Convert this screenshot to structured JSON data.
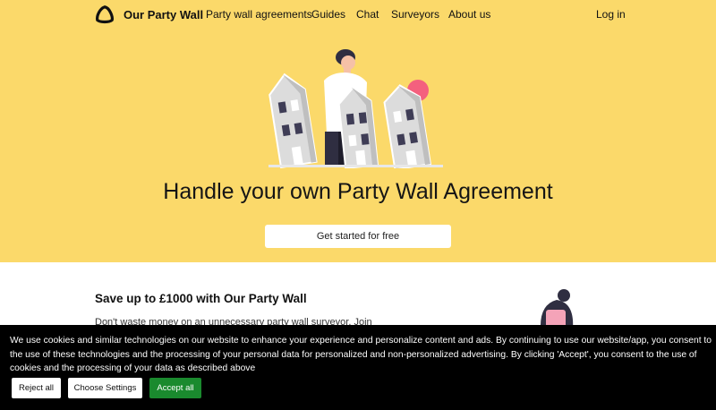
{
  "nav": {
    "brand": "Our Party Wall",
    "links": [
      "Party wall agreements",
      "Guides",
      "Chat",
      "Surveyors",
      "About us"
    ],
    "login": "Log in"
  },
  "hero": {
    "title": "Handle your own Party Wall Agreement",
    "cta": "Get started for free"
  },
  "section": {
    "title": "Save up to £1000 with Our Party Wall",
    "text": "Don't waste money on an unnecessary party wall surveyor. Join"
  },
  "cookie": {
    "message": "We use cookies and similar technologies on our website to enhance your experience and personalize content and ads. By continuing to use our website/app, you consent to the use of these technologies and the processing of your personal data for personalized and non-personalized advertising. By clicking 'Accept', you consent to the use of cookies and the processing of your data as described above",
    "reject": "Reject all",
    "settings": "Choose Settings",
    "accept": "Accept all"
  },
  "colors": {
    "hero_bg": "#fbd96a",
    "accent_pink": "#f4607e",
    "accept_green": "#1a8a2e",
    "banner_bg": "#000000"
  }
}
